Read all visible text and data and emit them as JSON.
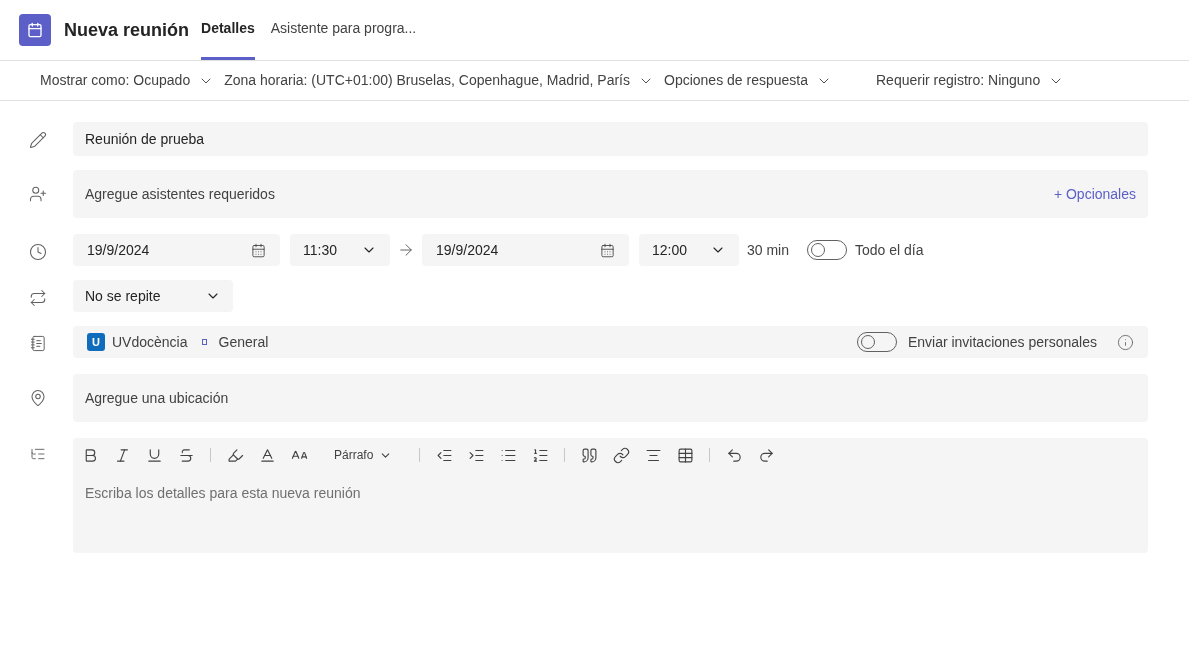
{
  "header": {
    "title": "Nueva reunión",
    "tabs": [
      {
        "label": "Detalles",
        "selected": true
      },
      {
        "label": "Asistente para progra...",
        "selected": false
      }
    ]
  },
  "options_bar": [
    "Mostrar como: Ocupado",
    "Zona horaria: (UTC+01:00) Bruselas, Copenhague, Madrid, París",
    "Opciones de respuesta",
    "Requerir registro: Ninguno"
  ],
  "title_field": {
    "value": "Reunión de prueba"
  },
  "attendees": {
    "placeholder": "Agregue asistentes requeridos",
    "optional_link": "+ Opcionales"
  },
  "schedule": {
    "start_date": "19/9/2024",
    "start_time": "11:30",
    "end_date": "19/9/2024",
    "end_time": "12:00",
    "duration": "30 min",
    "all_day": {
      "label": "Todo el día",
      "on": false
    }
  },
  "repeat": {
    "value": "No se repite"
  },
  "channel": {
    "team_badge": "U",
    "team": "UVdocència",
    "channel": "General",
    "personal_invites": {
      "label": "Enviar invitaciones personales",
      "on": false
    }
  },
  "location": {
    "placeholder": "Agregue una ubicación"
  },
  "editor": {
    "paragraph_style": "Párrafo",
    "placeholder": "Escriba los detalles para esta nueva reunión"
  }
}
